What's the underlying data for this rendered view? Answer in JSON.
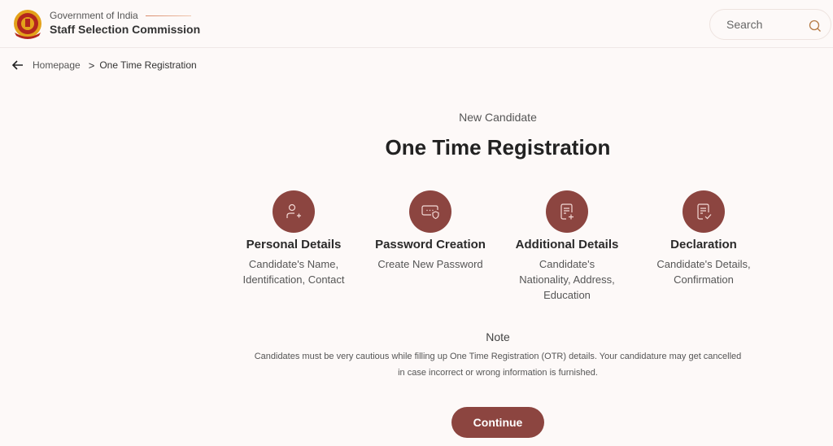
{
  "header": {
    "org_gov": "Government of India",
    "org_name": "Staff Selection Commission",
    "logo_icon": "ssc-emblem-icon",
    "search_placeholder": "Search",
    "search_icon": "search-icon"
  },
  "breadcrumb": {
    "back_icon": "arrow-left-icon",
    "home": "Homepage",
    "separator": ">",
    "current": "One Time Registration"
  },
  "main": {
    "subtitle": "New Candidate",
    "title": "One Time Registration",
    "steps": [
      {
        "icon": "user-add-icon",
        "title": "Personal Details",
        "desc": "Candidate's Name, Identification, Contact"
      },
      {
        "icon": "password-shield-icon",
        "title": "Password Creation",
        "desc": "Create New Password"
      },
      {
        "icon": "document-add-icon",
        "title": "Additional Details",
        "desc": "Candidate's Nationality, Address, Education"
      },
      {
        "icon": "document-check-icon",
        "title": "Declaration",
        "desc": "Candidate's Details, Confirmation"
      }
    ],
    "note_title": "Note",
    "note_text": "Candidates must be very cautious while filling up One Time Registration (OTR) details. Your candidature may get cancelled in case incorrect or wrong information is furnished.",
    "continue_label": "Continue"
  },
  "colors": {
    "accent": "#8c4540",
    "background": "#fdf9f8"
  }
}
